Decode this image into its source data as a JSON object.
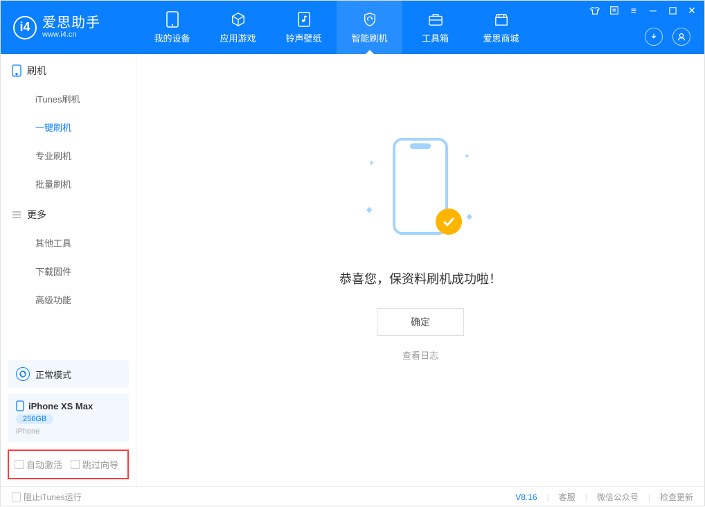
{
  "app": {
    "title": "爱思助手",
    "subtitle": "www.i4.cn"
  },
  "tabs": [
    {
      "label": "我的设备"
    },
    {
      "label": "应用游戏"
    },
    {
      "label": "铃声壁纸"
    },
    {
      "label": "智能刷机"
    },
    {
      "label": "工具箱"
    },
    {
      "label": "爱思商城"
    }
  ],
  "sidebar": {
    "group1": {
      "title": "刷机"
    },
    "items1": [
      {
        "label": "iTunes刷机"
      },
      {
        "label": "一键刷机"
      },
      {
        "label": "专业刷机"
      },
      {
        "label": "批量刷机"
      }
    ],
    "group2": {
      "title": "更多"
    },
    "items2": [
      {
        "label": "其他工具"
      },
      {
        "label": "下载固件"
      },
      {
        "label": "高级功能"
      }
    ]
  },
  "device_status": {
    "label": "正常模式"
  },
  "device": {
    "name": "iPhone XS Max",
    "storage": "256GB",
    "model": "iPhone"
  },
  "options": {
    "auto_activate": "自动激活",
    "skip_guide": "跳过向导"
  },
  "main": {
    "success_msg": "恭喜您，保资料刷机成功啦！",
    "ok_btn": "确定",
    "log_link": "查看日志"
  },
  "footer": {
    "block_itunes": "阻止iTunes运行",
    "version": "V8.16",
    "support": "客服",
    "wechat": "微信公众号",
    "update": "检查更新"
  }
}
